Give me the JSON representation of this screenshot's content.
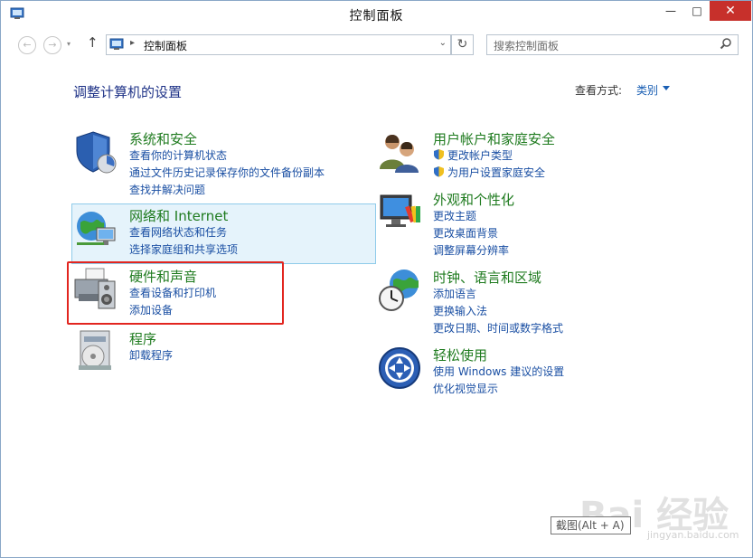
{
  "window": {
    "title": "控制面板",
    "minimize_glyph": "—",
    "maximize_glyph": "□",
    "close_glyph": "✕"
  },
  "toolbar": {
    "back_glyph": "←",
    "forward_glyph": "→",
    "recent_glyph": "▾",
    "up_glyph": "↑",
    "address_separator": "▸",
    "address_text": "控制面板",
    "address_dropdown_glyph": "⌄",
    "refresh_glyph": "↻",
    "search_placeholder": "搜索控制面板"
  },
  "header": {
    "page_title": "调整计算机的设置",
    "view_by_label": "查看方式:",
    "view_by_value": "类别"
  },
  "categories": [
    {
      "title": "系统和安全",
      "icon": "shield-security-icon",
      "links": [
        "查看你的计算机状态",
        "通过文件历史记录保存你的文件备份副本",
        "查找并解决问题"
      ]
    },
    {
      "title": "网络和 Internet",
      "icon": "globe-network-icon",
      "links": [
        "查看网络状态和任务",
        "选择家庭组和共享选项"
      ]
    },
    {
      "title": "硬件和声音",
      "icon": "printer-speaker-icon",
      "links": [
        "查看设备和打印机",
        "添加设备"
      ]
    },
    {
      "title": "程序",
      "icon": "programs-disc-icon",
      "links": [
        "卸载程序"
      ]
    },
    {
      "title": "用户帐户和家庭安全",
      "icon": "users-icon",
      "links": [
        "更改帐户类型",
        "为用户设置家庭安全"
      ]
    },
    {
      "title": "外观和个性化",
      "icon": "monitor-palette-icon",
      "links": [
        "更改主题",
        "更改桌面背景",
        "调整屏幕分辨率"
      ]
    },
    {
      "title": "时钟、语言和区域",
      "icon": "clock-globe-icon",
      "links": [
        "添加语言",
        "更换输入法",
        "更改日期、时间或数字格式"
      ]
    },
    {
      "title": "轻松使用",
      "icon": "ease-of-access-icon",
      "links": [
        "使用 Windows 建议的设置",
        "优化视觉显示"
      ]
    }
  ],
  "tooltip": "截图(Alt + A)",
  "watermark": {
    "text": "Bai 经验",
    "sub": "jingyan.baidu.com"
  },
  "colors": {
    "accent_title": "#1f7b1f",
    "link": "#1a4fa3",
    "heading": "#1e3287",
    "highlight_bg": "#e5f3fb",
    "close_button": "#c7302b",
    "annotation_box": "#e2251f"
  }
}
